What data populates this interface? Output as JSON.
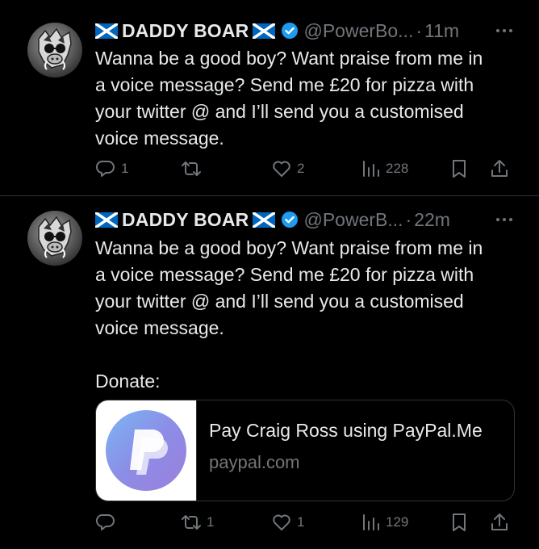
{
  "tweets": [
    {
      "display_name": "DADDY BOAR",
      "handle": "@PowerBo...",
      "time": "11m",
      "lines": [
        "Wanna be a good boy? Want praise from me in",
        "a voice message? Send me £20 for pizza with",
        "your twitter @ and I’ll send you a customised",
        "voice message."
      ],
      "actions": {
        "replies": "1",
        "reposts": "",
        "likes": "2",
        "views": "228"
      }
    },
    {
      "display_name": "DADDY BOAR",
      "handle": "@PowerB...",
      "time": "22m",
      "lines": [
        "Wanna be a good boy? Want praise from me in",
        "a voice message? Send me £20 for pizza with",
        "your twitter @ and I’ll send you a customised",
        "voice message."
      ],
      "extra_line": "Donate:",
      "card": {
        "title": "Pay Craig Ross using PayPal.Me",
        "domain": "paypal.com"
      },
      "actions": {
        "replies": "",
        "reposts": "1",
        "likes": "1",
        "views": "129"
      }
    }
  ],
  "separator": "·",
  "icons": {
    "flag": "scotland-flag-icon",
    "verified": "verified-badge-icon",
    "more": "more-icon",
    "reply": "reply-icon",
    "repost": "repost-icon",
    "like": "like-icon",
    "views": "views-icon",
    "bookmark": "bookmark-icon",
    "share": "share-icon"
  },
  "colors": {
    "background": "#000000",
    "text": "#e7e9ea",
    "muted": "#71767b",
    "verified": "#1d9bf0",
    "flag_blue": "#0065bd"
  }
}
